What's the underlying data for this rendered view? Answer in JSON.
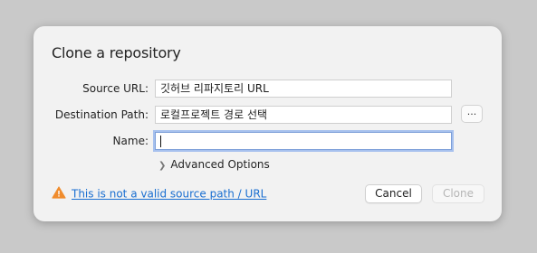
{
  "dialog": {
    "title": "Clone a repository",
    "source_url": {
      "label": "Source URL:",
      "value": "깃허브 리파지토리 URL"
    },
    "destination_path": {
      "label": "Destination Path:",
      "value": "로컬프로젝트 경로 선택",
      "browse_label": "..."
    },
    "name": {
      "label": "Name:",
      "value": ""
    },
    "advanced_options": "Advanced Options",
    "warning": {
      "icon": "warning-triangle-icon",
      "text": "This is not a valid source path / URL",
      "color": "#f08c2d"
    },
    "buttons": {
      "cancel": "Cancel",
      "clone": "Clone"
    }
  },
  "colors": {
    "link": "#1a6fd1",
    "focus_ring": "#a7c1ee",
    "backdrop": "#c9c9c9",
    "dialog_bg": "#f2f2f2"
  }
}
